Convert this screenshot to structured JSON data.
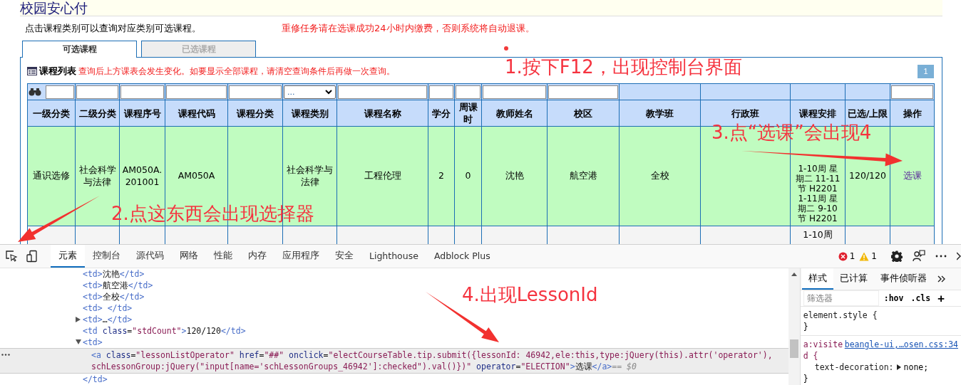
{
  "page": {
    "title": "校园安心付",
    "hint": "点击课程类别可以查询对应类别可选课程。",
    "notice": "重修任务请在选课成功24小时内缴费，否则系统将自动退课。",
    "tabs": [
      {
        "label": "可选课程",
        "selected": true
      },
      {
        "label": "已选课程",
        "selected": false
      }
    ],
    "list_title": "课程列表",
    "list_note": "查询后上方课表会发生变化。如要显示全部课程，请清空查询条件后再做一次查询。",
    "page_number": "1",
    "filters": [
      {
        "kind": "text"
      },
      {
        "kind": "text"
      },
      {
        "kind": "text"
      },
      {
        "kind": "text"
      },
      {
        "kind": "text"
      },
      {
        "kind": "select"
      },
      {
        "kind": "text"
      },
      {
        "kind": "text"
      },
      {
        "kind": "text"
      },
      {
        "kind": "text"
      },
      {
        "kind": "text"
      },
      {
        "kind": "none"
      },
      {
        "kind": "none"
      },
      {
        "kind": "none"
      },
      {
        "kind": "none"
      },
      {
        "kind": "text"
      }
    ],
    "filter_select_value": "...",
    "columns": [
      "一级分类",
      "二级分类",
      "课程序号",
      "课程代码",
      "课程分类",
      "课程类别",
      "课程名称",
      "学分",
      "周课时",
      "教师姓名",
      "校区",
      "教学班",
      "行政班",
      "课程安排",
      "已选/上限",
      "操作"
    ],
    "rows": [
      {
        "highlighted": true,
        "cells": [
          "通识选修",
          "社会科学与法律",
          "AM050A.201001",
          "AM050A",
          null,
          "社会科学与法律",
          "工程伦理",
          "2",
          "0",
          "沈艳",
          "航空港",
          "全校",
          null,
          "1-10周 星期二 11-11节 H2201 1-11周 星期二 9-10节 H2201",
          "120/120"
        ],
        "action": "选课"
      },
      {
        "highlighted": false,
        "cells": [
          null,
          null,
          null,
          null,
          null,
          null,
          null,
          null,
          null,
          null,
          null,
          null,
          null,
          "1-10周",
          null
        ]
      }
    ]
  },
  "annotations": [
    "1.按下F12，出现控制台界面",
    "2.点这东西会出现选择器",
    "3.点“选课”会出现4",
    "4.出现LessonId"
  ],
  "devtools": {
    "tabs": [
      {
        "label": "元素",
        "selected": true
      },
      {
        "label": "控制台",
        "selected": false
      },
      {
        "label": "源代码",
        "selected": false
      },
      {
        "label": "网络",
        "selected": false
      },
      {
        "label": "性能",
        "selected": false
      },
      {
        "label": "内存",
        "selected": false
      },
      {
        "label": "应用程序",
        "selected": false
      },
      {
        "label": "安全",
        "selected": false
      },
      {
        "label": "Lighthouse",
        "selected": false
      },
      {
        "label": "Adblock Plus",
        "selected": false
      }
    ],
    "error_count": "1",
    "warning_count": "1",
    "dom_tree": [
      {
        "markup": "<td>沈艳</td>",
        "kind": "leaf",
        "selected": false
      },
      {
        "markup": "<td>航空港</td>",
        "kind": "leaf",
        "selected": false
      },
      {
        "markup": "<td>全校</td>",
        "kind": "leaf",
        "selected": false
      },
      {
        "markup": "<td> </td>",
        "kind": "leaf",
        "selected": false
      },
      {
        "markup": "<td>…</td>",
        "kind": "collapsed",
        "selected": false
      },
      {
        "markup": "<td class=\"stdCount\">120/120</td>",
        "kind": "leaf",
        "selected": false
      },
      {
        "markup": "<td>",
        "kind": "expanded",
        "selected": false,
        "closing": "</td>",
        "children": [
          {
            "markup": "<a class=\"lessonListOperator\" href=\"##\" onclick=\"electCourseTable.tip.submit({lessonId: 46942,ele:this,type:jQuery(this).attr('operator'), schLessonGroup:jQuery(\"input[name='schLessonGroups_46942']:checked\").val()})\" operator=\"ELECTION\">选课</a>",
            "selected": true,
            "marker": "== $0"
          }
        ]
      }
    ],
    "styles": {
      "tabs": [
        {
          "label": "样式",
          "selected": true
        },
        {
          "label": "已计算",
          "selected": false
        },
        {
          "label": "事件侦听器",
          "selected": false
        }
      ],
      "filter_placeholder": "筛选器",
      "hov": ":hov",
      "cls": ".cls",
      "add": "+",
      "rules": [
        {
          "selector": "element.style {",
          "closing": "}"
        },
        {
          "selector": "a:visited {",
          "source": "beangle-ui,…osen.css:34",
          "declarations": [
            {
              "property": "text-decoration:",
              "value": "none;",
              "expandable": true
            }
          ],
          "closing": "}"
        }
      ]
    }
  }
}
